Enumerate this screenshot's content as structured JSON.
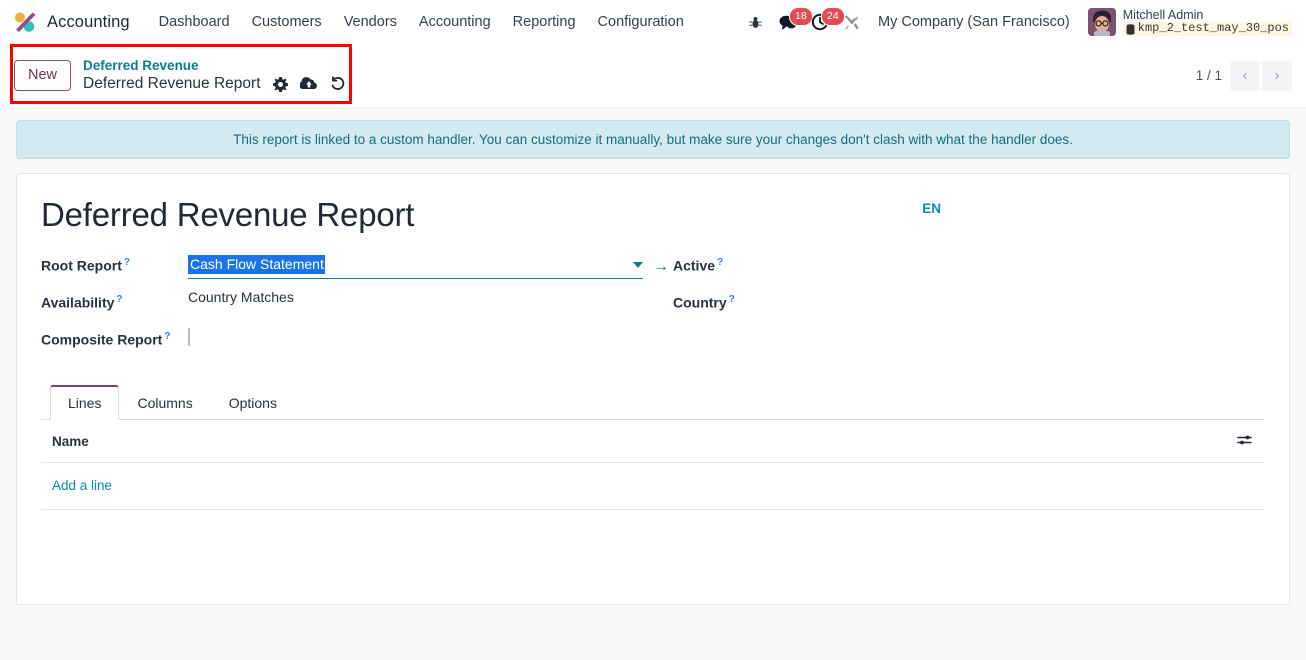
{
  "navbar": {
    "brand": "Accounting",
    "logo_icon": "odoo-logo-icon",
    "menu_items": [
      {
        "label": "Dashboard"
      },
      {
        "label": "Customers"
      },
      {
        "label": "Vendors"
      },
      {
        "label": "Accounting"
      },
      {
        "label": "Reporting"
      },
      {
        "label": "Configuration"
      }
    ],
    "sys_icons": [
      {
        "name": "bug-icon",
        "glyph": "🐞"
      },
      {
        "name": "messages-icon",
        "glyph": "💬",
        "badge": "18"
      },
      {
        "name": "activities-clock-icon",
        "glyph": "⏱",
        "badge": "24"
      },
      {
        "name": "tools-icon",
        "glyph": "⚒"
      }
    ],
    "messages_badge": "18",
    "activities_badge": "24",
    "company": "My Company (San Francisco)",
    "user_name": "Mitchell Admin",
    "database_name": "kmp_2_test_may_30_pos",
    "database_icon": "database-icon"
  },
  "control_panel": {
    "new_button": "New",
    "breadcrumb_parent": "Deferred Revenue",
    "breadcrumb_current": "Deferred Revenue Report",
    "actions": [
      {
        "name": "gear-icon",
        "title": "Actions"
      },
      {
        "name": "cloud-upload-save-icon",
        "title": "Save manually"
      },
      {
        "name": "undo-discard-icon",
        "title": "Discard changes"
      }
    ],
    "pager_value": "1 / 1",
    "pager_previous": "‹",
    "pager_next": "›",
    "highlight_color": "#ff0000"
  },
  "alert": {
    "text": "This report is linked to a custom handler. You can customize it manually, but make sure your changes don't clash with what the handler does."
  },
  "form": {
    "title": "Deferred Revenue Report",
    "language_link": "EN",
    "fields": {
      "root_report": {
        "label": "Root Report",
        "value": "Cash Flow Statement",
        "placeholder": "",
        "selected": true,
        "dropdown_icon": "chevron-down-icon",
        "internal_link_icon": "arrow-right-icon"
      },
      "availability": {
        "label": "Availability",
        "value": "Country Matches"
      },
      "composite_report": {
        "label": "Composite Report",
        "checked": false
      },
      "active": {
        "label": "Active",
        "checked": true,
        "on_color": "#1aa64b"
      },
      "country": {
        "label": "Country",
        "value": ""
      }
    }
  },
  "notebook": {
    "tabs": [
      {
        "label": "Lines",
        "active": true
      },
      {
        "label": "Columns",
        "active": false
      },
      {
        "label": "Options",
        "active": false
      }
    ],
    "lines_table": {
      "columns": [
        "Name"
      ],
      "rows": [],
      "add_line_label": "Add a line",
      "optional_columns_icon": "sliders-icon"
    }
  }
}
